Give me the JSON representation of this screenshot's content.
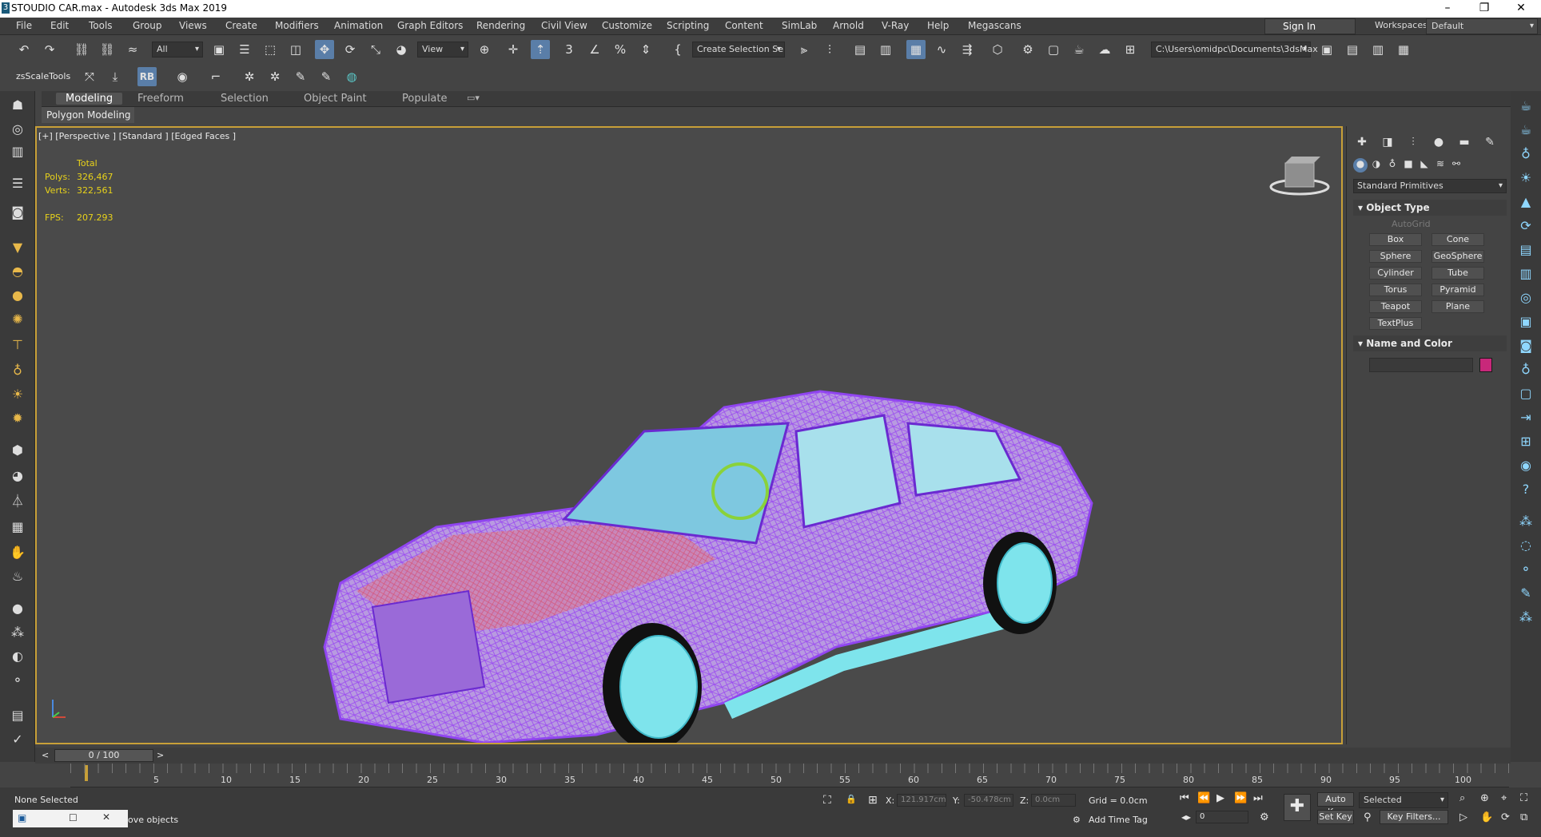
{
  "window": {
    "title": "STOUDIO  CAR.max - Autodesk 3ds Max 2019",
    "app_icon": "3"
  },
  "menu": [
    "File",
    "Edit",
    "Tools",
    "Group",
    "Views",
    "Create",
    "Modifiers",
    "Animation",
    "Graph Editors",
    "Rendering",
    "Civil View",
    "Customize",
    "Scripting",
    "Content",
    "SimLab",
    "Arnold",
    "V-Ray",
    "Help",
    "Megascans"
  ],
  "signin": "Sign In",
  "workspaces": {
    "label": "Workspaces:",
    "value": "Default"
  },
  "toolbar": {
    "filter": "All",
    "view": "View",
    "selection_set": "Create Selection Se",
    "path": "C:\\Users\\omidpc\\Documents\\3dsMax"
  },
  "toolbar2": {
    "scale_tools": "zsScaleTools",
    "rb": "RB"
  },
  "ribbon": {
    "tabs": [
      "Modeling",
      "Freeform",
      "Selection",
      "Object Paint",
      "Populate"
    ],
    "sub": "Polygon Modeling"
  },
  "viewport": {
    "label": "[+] [Perspective ] [Standard ] [Edged Faces ]",
    "stats": {
      "total_label": "Total",
      "polys_label": "Polys:",
      "polys": "326,467",
      "verts_label": "Verts:",
      "verts": "322,561",
      "fps_label": "FPS:",
      "fps": "207.293"
    }
  },
  "command_panel": {
    "category": "Standard Primitives",
    "object_type": "Object Type",
    "autogrid": "AutoGrid",
    "primitives": [
      "Box",
      "Cone",
      "Sphere",
      "GeoSphere",
      "Cylinder",
      "Tube",
      "Torus",
      "Pyramid",
      "Teapot",
      "Plane",
      "TextPlus"
    ],
    "name_and_color": "Name and Color",
    "swatch_color": "#c8287a"
  },
  "timeline": {
    "frame": "0 / 100",
    "prev": "<",
    "next": ">",
    "ticks": [
      "5",
      "10",
      "15",
      "20",
      "25",
      "30",
      "35",
      "40",
      "45",
      "50",
      "55",
      "60",
      "65",
      "70",
      "75",
      "80",
      "85",
      "90",
      "95",
      "100"
    ]
  },
  "status": {
    "selection": "None Selected",
    "prompt": "ove objects",
    "x_label": "X:",
    "x": "121.917cm",
    "y_label": "Y:",
    "y": "-50.478cm",
    "z_label": "Z:",
    "z": "0.0cm",
    "grid": "Grid = 0.0cm",
    "add_time_tag": "Add Time Tag",
    "auto_key": "Auto Key",
    "set_key": "Set Key",
    "key_mode": "Selected",
    "key_filters": "Key Filters...",
    "frame_field": "0"
  },
  "colors": {
    "accent": "#5a7ea8",
    "viewport_border": "#c8a038",
    "stats": "#e8d21a"
  }
}
